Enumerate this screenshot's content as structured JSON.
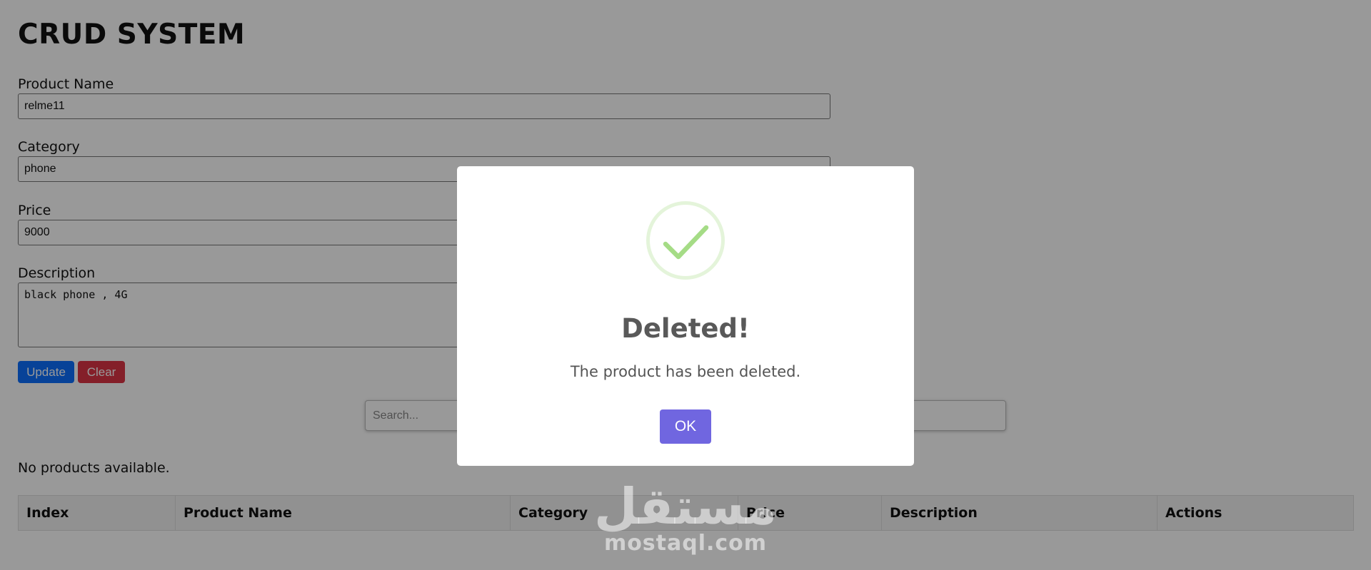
{
  "app": {
    "title": "CRUD SYSTEM"
  },
  "form": {
    "product_name_label": "Product Name",
    "product_name_value": "relme11",
    "category_label": "Category",
    "category_value": "phone",
    "price_label": "Price",
    "price_value": "9000",
    "description_label": "Description",
    "description_value": "black phone , 4G",
    "update_label": "Update",
    "clear_label": "Clear"
  },
  "search": {
    "placeholder": "Search..."
  },
  "products": {
    "empty_message": "No products available."
  },
  "table": {
    "columns": [
      "Index",
      "Product Name",
      "Category",
      "Price",
      "Description",
      "Actions"
    ]
  },
  "dialog": {
    "icon": "check-icon",
    "title": "Deleted!",
    "text": "The product has been deleted.",
    "ok_label": "OK"
  },
  "watermark": {
    "arabic": "مستقل",
    "latin": "mostaql.com"
  },
  "colors": {
    "update_button": "#0d6efd",
    "clear_button": "#dc3545",
    "ok_button": "#7066e0",
    "success_green": "#a5dc86"
  }
}
